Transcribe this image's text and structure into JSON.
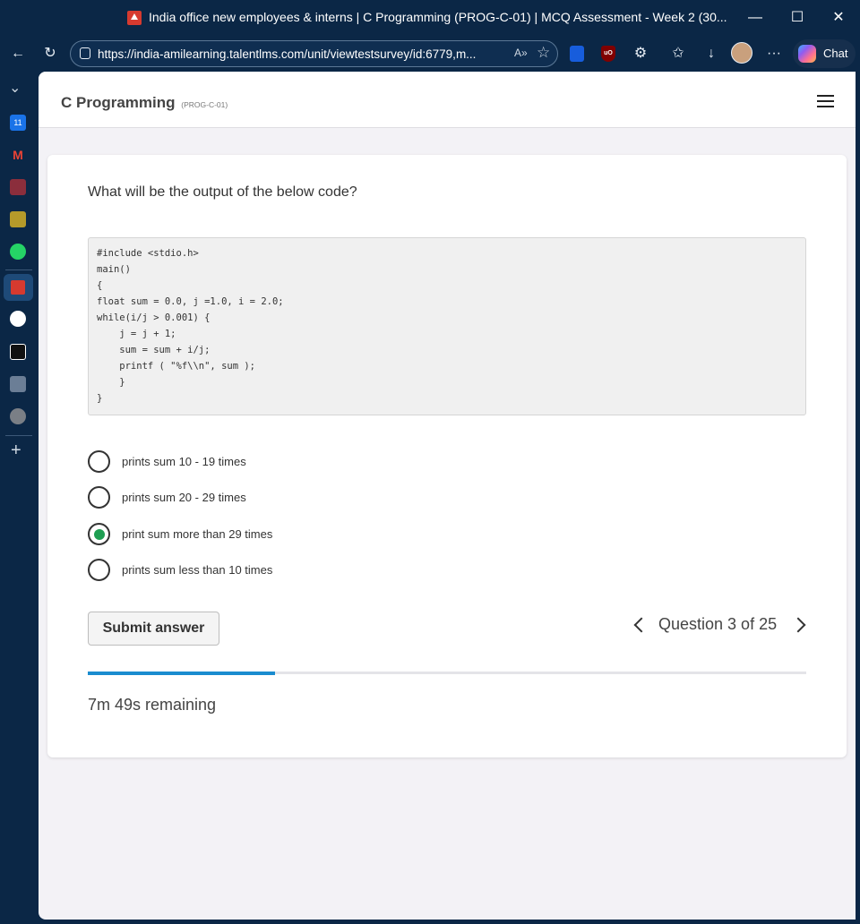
{
  "browser": {
    "window_title": "India office new employees & interns | C Programming (PROG-C-01) | MCQ Assessment - Week 2 (30...",
    "url": "https://india-amilearning.talentlms.com/unit/viewtestsurvey/id:6779,m...",
    "chat_label": "Chat",
    "minimize": "—",
    "maximize": "☐",
    "close": "✕",
    "back": "←",
    "refresh": "↻",
    "read_aloud": "A»",
    "favorite": "☆",
    "extensions": "⚙",
    "favorites": "✩",
    "downloads": "↓",
    "more": "···"
  },
  "sidebar": {
    "collapse": "⌄",
    "calendar_badge": "11",
    "gmail": "M",
    "add": "+"
  },
  "page": {
    "course_title": "C Programming",
    "course_code": "(PROG-C-01)"
  },
  "quiz": {
    "question": "What will be the output of the below code?",
    "code_lines": [
      "#include <stdio.h>",
      "main()",
      "{",
      "float sum = 0.0, j =1.0, i = 2.0;",
      "while(i/j > 0.001) {",
      "    j = j + 1;",
      "    sum = sum + i/j;",
      "    printf ( \"%f\\\\n\", sum );",
      "    }",
      "}"
    ],
    "options": [
      {
        "label": "prints sum 10 - 19 times",
        "selected": false
      },
      {
        "label": "prints sum 20 - 29 times",
        "selected": false
      },
      {
        "label": "print sum more than 29 times",
        "selected": true
      },
      {
        "label": "prints sum less than 10 times",
        "selected": false
      }
    ],
    "submit_label": "Submit answer",
    "pager_text": "Question 3 of 25",
    "progress_fraction": 0.26,
    "remaining_text": "7m 49s remaining"
  },
  "colors": {
    "frame": "#0b2746",
    "radio_selected": "#1e9e52",
    "progress": "#1a8ccf"
  }
}
